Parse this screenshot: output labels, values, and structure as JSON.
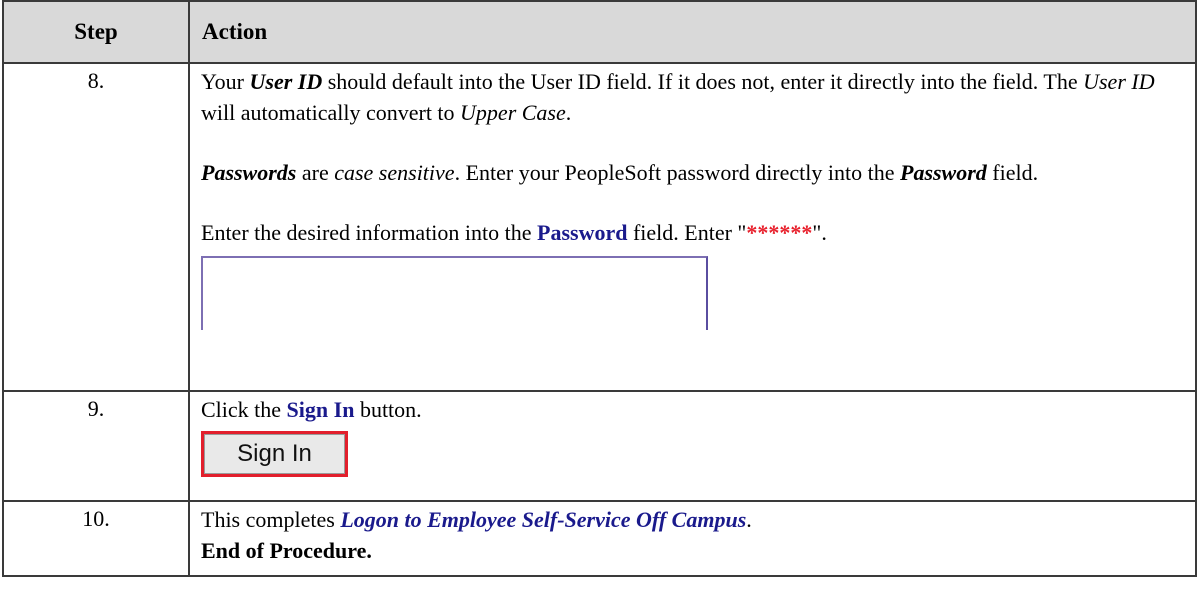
{
  "header": {
    "step": "Step",
    "action": "Action"
  },
  "rows": {
    "r8": {
      "num": "8.",
      "p1": [
        "Your ",
        "User ID",
        " should default into the User ID field. If it does not, enter it directly into the field. The ",
        "User ID",
        " will automatically convert to ",
        "Upper Case",
        "."
      ],
      "p2": [
        "Passwords",
        " are ",
        "case sensitive",
        ". Enter your PeopleSoft password directly into the ",
        "Password",
        " field."
      ],
      "p3": [
        "Enter the desired information into the ",
        "Password",
        " field. Enter \"",
        "******",
        "\"."
      ]
    },
    "r9": {
      "num": "9.",
      "p1": [
        "Click the ",
        "Sign In",
        " button."
      ],
      "button_label": "Sign In"
    },
    "r10": {
      "num": "10.",
      "p1": [
        "This completes ",
        "Logon to Employee Self-Service Off Campus",
        "."
      ],
      "p2": "End of Procedure."
    }
  },
  "colors": {
    "accent": "#1a1a8c",
    "highlight_red": "#e8202c",
    "header_bg": "#d9d9d9"
  }
}
